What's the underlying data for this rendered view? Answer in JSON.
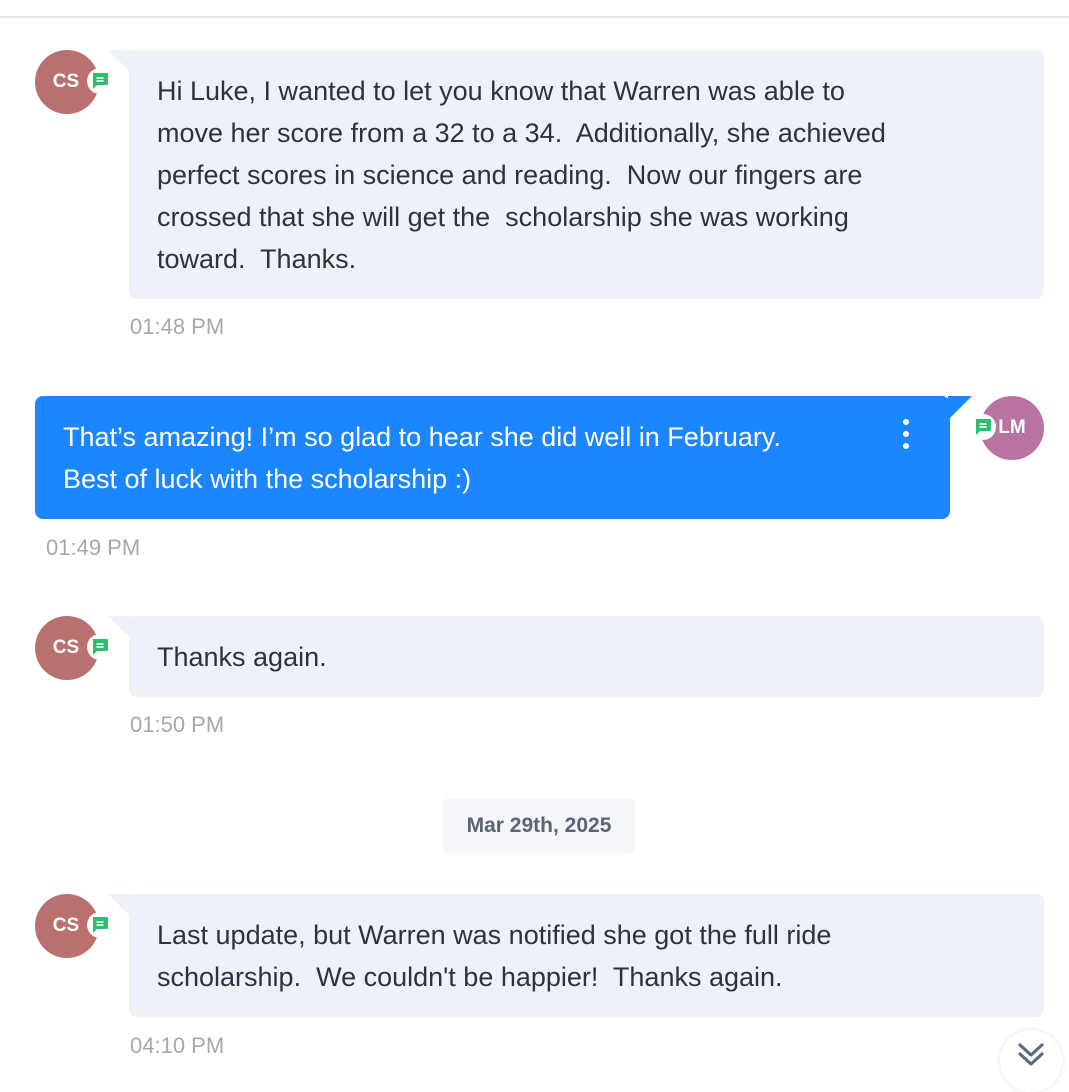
{
  "conversation": {
    "date_separator": "Mar 29th, 2025",
    "messages": [
      {
        "sender_initials": "CS",
        "direction": "incoming",
        "lines": [
          "Hi Luke, I wanted to let you know that Warren was able to",
          "move her score from a 32 to a 34.  Additionally, she achieved",
          "perfect scores in science and reading.  Now our fingers are",
          "crossed that she will get the  scholarship she was working",
          "toward.  Thanks."
        ],
        "time": "01:48 PM",
        "channel_icon": "sms-chat-icon"
      },
      {
        "sender_initials": "LM",
        "direction": "outgoing",
        "lines": [
          "That’s amazing! I’m so glad to hear she did well in February.",
          "Best of luck with the scholarship :)"
        ],
        "time": "01:49 PM",
        "channel_icon": "sms-chat-icon",
        "menu_icon": "more-vertical-icon"
      },
      {
        "sender_initials": "CS",
        "direction": "incoming",
        "lines": [
          "Thanks again."
        ],
        "time": "01:50 PM",
        "channel_icon": "sms-chat-icon"
      },
      {
        "sender_initials": "CS",
        "direction": "incoming",
        "lines": [
          "Last update, but Warren was notified she got the full ride",
          "scholarship.  We couldn't be happier!  Thanks again."
        ],
        "time": "04:10 PM",
        "channel_icon": "sms-chat-icon"
      }
    ],
    "scroll_button_icon": "double-chevron-down-icon"
  },
  "colors": {
    "incoming_bubble": "#eff1f8",
    "outgoing_bubble": "#1b86ff",
    "avatar_cs": "#b9706e",
    "avatar_lm": "#b973a2",
    "channel_badge": "#2dbd6e",
    "timestamp": "#a4a9b0"
  }
}
